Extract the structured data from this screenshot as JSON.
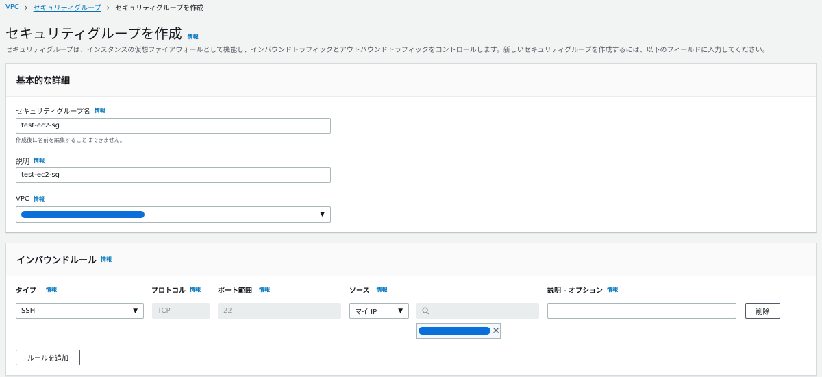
{
  "breadcrumb": {
    "items": [
      "VPC",
      "セキュリティグループ"
    ],
    "current": "セキュリティグループを作成"
  },
  "page": {
    "title": "セキュリティグループを作成",
    "info": "情報",
    "description": "セキュリティグループは、インスタンスの仮想ファイアウォールとして機能し、インバウンドトラフィックとアウトバウンドトラフィックをコントロールします。新しいセキュリティグループを作成するには、以下のフィールドに入力してください。"
  },
  "basic": {
    "header": "基本的な詳細",
    "name_label": "セキュリティグループ名",
    "name_info": "情報",
    "name_value": "test-ec2-sg",
    "name_hint": "作成後に名前を編集することはできません。",
    "desc_label": "説明",
    "desc_info": "情報",
    "desc_value": "test-ec2-sg",
    "vpc_label": "VPC",
    "vpc_info": "情報"
  },
  "inbound": {
    "header": "インバウンドルール",
    "info": "情報",
    "columns": {
      "type": "タイプ",
      "protocol": "プロトコル",
      "port": "ポート範囲",
      "source": "ソース",
      "description": "説明 - オプション"
    },
    "col_info": "情報",
    "row": {
      "type": "SSH",
      "protocol": "TCP",
      "port": "22",
      "source": "マイ IP",
      "description": ""
    },
    "delete_label": "削除",
    "add_rule_label": "ルールを追加"
  }
}
